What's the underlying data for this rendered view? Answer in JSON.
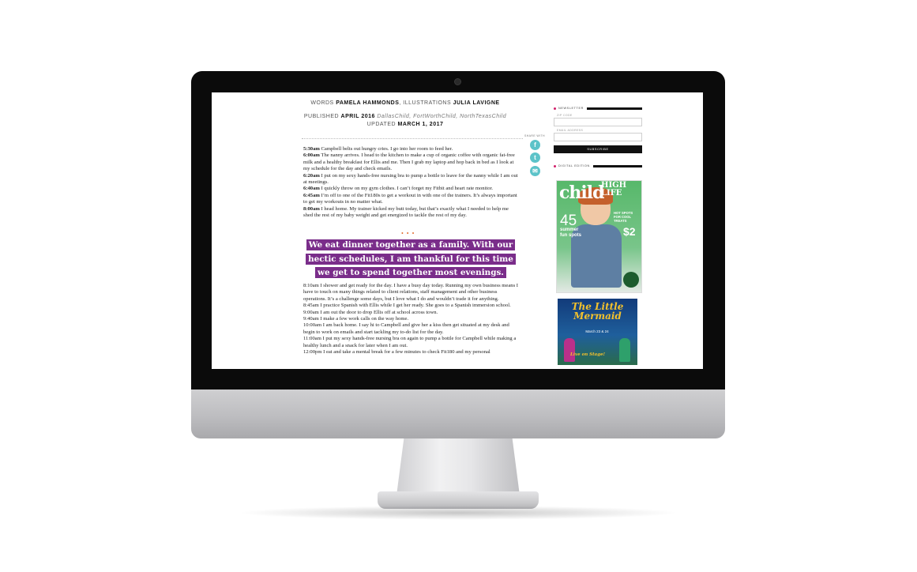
{
  "byline": {
    "words_label": "WORDS",
    "author": "PAMELA HAMMONDS",
    "illustrations_label": ", ILLUSTRATIONS",
    "illustrator": "JULIA LAVIGNE",
    "published_label": "PUBLISHED",
    "published_date": "APRIL 2016",
    "publications": "DallasChild, FortWorthChild, NorthTexasChild",
    "updated_label": "UPDATED",
    "updated_date": "MARCH 1, 2017"
  },
  "share": {
    "label": "SHARE WITH",
    "icons": [
      "facebook-icon",
      "twitter-icon",
      "email-icon"
    ]
  },
  "schedule_morning": [
    {
      "time": "5:30am",
      "text": " Campbell belts out hungry cries. I go into her room to feed her."
    },
    {
      "time": "6:00am",
      "text": " The nanny arrives. I head to the kitchen to make a cup of organic coffee with organic fat-free milk and a healthy breakfast for Ellis and me. Then I grab my laptop and hop back in bed as I look at my schedule for the day and check emails."
    },
    {
      "time": "6:20am",
      "text": " I put on my sexy hands-free nursing bra to pump a bottle to leave for the nanny while I am out at meetings."
    },
    {
      "time": "6:40am",
      "text": " I quickly throw on my gym clothes. I can’t forget my Fitbit and heart rate monitor."
    },
    {
      "time": "6:45am",
      "text": " I’m off to one of the Fit180s to get a workout in with one of the trainers. It’s always important to get my workouts in no matter what."
    },
    {
      "time": "8:00am",
      "text": " I head home. My trainer kicked my butt today, but that’s exactly what I needed to help me shed the rest of my baby weight and get energized to tackle the rest of my day."
    }
  ],
  "separator": "• • •",
  "pull_quote": "We eat dinner together as a family. With our hectic schedules, I am thankful for this time we get to spend together most evenings.",
  "schedule_later": [
    "8:10am I shower and get ready for the day. I have a busy day today. Running my own business means I have to touch on many things related to client relations, staff management and other business operations. It’s a challenge some days, but I love what I do and wouldn’t trade it for anything.",
    "8:45am I practice Spanish with Ellis while I get her ready. She goes to a Spanish immersion school.",
    "9:00am I am out the door to drop Ellis off at school across town.",
    "9:40am I make a few work calls on the way home.",
    "10:00am I am back home. I say hi to Campbell and give her a kiss then get situated at my desk and begin to work on emails and start tackling my to-do list for the day.",
    "11:00am I put my sexy hands-free nursing bra on again to pump a bottle for Campbell while making a healthy lunch and a snack for later when I am out.",
    "12:00pm I eat and take a mental break for a few minutes to check Fit180 and my personal"
  ],
  "sidebar": {
    "newsletter_heading": "NEWSLETTER",
    "zip_label": "ZIP CODE",
    "email_label": "EMAIL ADDRESS",
    "subscribe_label": "SUBSCRIBE",
    "digital_heading": "DIGITAL EDITION",
    "cover": {
      "logo": "child",
      "headline": "HIGH LIFE",
      "number": "45",
      "spots": "summer fun spots",
      "hot": "HOT SPOTS FOR COOL TREATS",
      "price": "$2"
    },
    "ad": {
      "title": "The Little Mermaid",
      "dates": "March 23 & 24",
      "tagline": "Live on Stage!"
    }
  },
  "colors": {
    "pull_quote_bg": "#7a2d8a",
    "share_icon": "#5cc3c9",
    "separator": "#e26a2c",
    "sidebar_dot": "#d11f6a"
  }
}
